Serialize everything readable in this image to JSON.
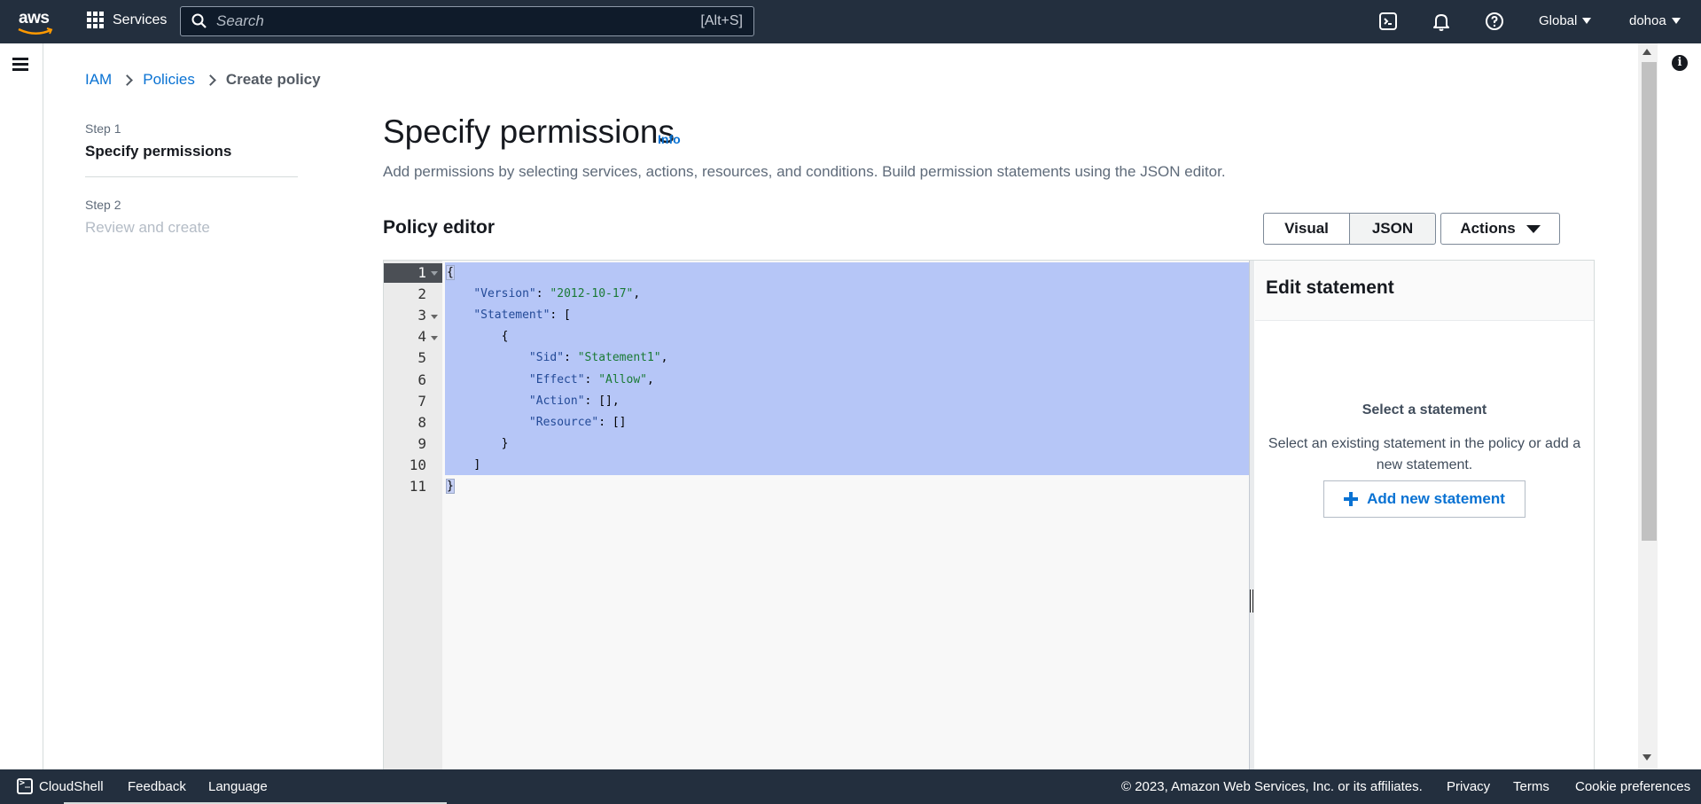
{
  "topnav": {
    "logo_text": "aws",
    "services_label": "Services",
    "search_placeholder": "Search",
    "search_shortcut": "[Alt+S]",
    "region_label": "Global",
    "account_label": "dohoa"
  },
  "breadcrumb": {
    "items": [
      "IAM",
      "Policies"
    ],
    "current": "Create policy"
  },
  "steps": [
    {
      "label": "Step 1",
      "title": "Specify permissions",
      "active": true
    },
    {
      "label": "Step 2",
      "title": "Review and create",
      "active": false
    }
  ],
  "main": {
    "title": "Specify permissions",
    "info_label": "Info",
    "description": "Add permissions by selecting services, actions, resources, and conditions. Build permission statements using the JSON editor.",
    "section_title": "Policy editor",
    "mode_visual": "Visual",
    "mode_json": "JSON",
    "selected_mode": "JSON",
    "actions_label": "Actions"
  },
  "editor": {
    "line_numbers": [
      "1",
      "2",
      "3",
      "4",
      "5",
      "6",
      "7",
      "8",
      "9",
      "10",
      "11"
    ],
    "lines": [
      {
        "indent": "",
        "parts": [
          [
            "p",
            "{"
          ]
        ]
      },
      {
        "indent": "    ",
        "parts": [
          [
            "k",
            "\"Version\""
          ],
          [
            "p",
            ": "
          ],
          [
            "s",
            "\"2012-10-17\""
          ],
          [
            "p",
            ","
          ]
        ]
      },
      {
        "indent": "    ",
        "parts": [
          [
            "k",
            "\"Statement\""
          ],
          [
            "p",
            ": ["
          ]
        ]
      },
      {
        "indent": "        ",
        "parts": [
          [
            "p",
            "{"
          ]
        ]
      },
      {
        "indent": "            ",
        "parts": [
          [
            "k",
            "\"Sid\""
          ],
          [
            "p",
            ": "
          ],
          [
            "s",
            "\"Statement1\""
          ],
          [
            "p",
            ","
          ]
        ]
      },
      {
        "indent": "            ",
        "parts": [
          [
            "k",
            "\"Effect\""
          ],
          [
            "p",
            ": "
          ],
          [
            "s",
            "\"Allow\""
          ],
          [
            "p",
            ","
          ]
        ]
      },
      {
        "indent": "            ",
        "parts": [
          [
            "k",
            "\"Action\""
          ],
          [
            "p",
            ": [],"
          ]
        ]
      },
      {
        "indent": "            ",
        "parts": [
          [
            "k",
            "\"Resource\""
          ],
          [
            "p",
            ": []"
          ]
        ]
      },
      {
        "indent": "        ",
        "parts": [
          [
            "p",
            "}"
          ]
        ]
      },
      {
        "indent": "    ",
        "parts": [
          [
            "p",
            "]"
          ]
        ]
      },
      {
        "indent": "",
        "parts": [
          [
            "p",
            "}"
          ]
        ]
      }
    ]
  },
  "statement_panel": {
    "title": "Edit statement",
    "subtitle": "Select a statement",
    "description": "Select an existing statement in the policy or add a new statement.",
    "add_button": "Add new statement"
  },
  "footer": {
    "cloudshell": "CloudShell",
    "feedback": "Feedback",
    "language": "Language",
    "copyright": "© 2023, Amazon Web Services, Inc. or its affiliates.",
    "privacy": "Privacy",
    "terms": "Terms",
    "cookies": "Cookie preferences"
  },
  "colors": {
    "nav_bg": "#232f3e",
    "link": "#0972d3",
    "selection": "#b6c6f7"
  }
}
